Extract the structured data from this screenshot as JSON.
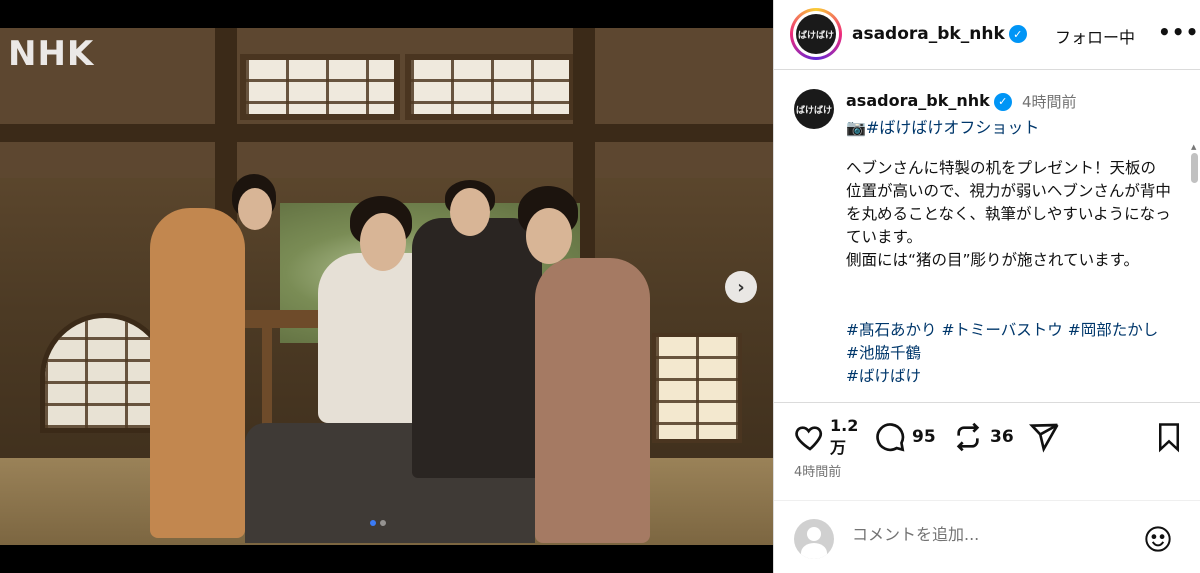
{
  "media": {
    "watermark": "NHK",
    "next_glyph": "›",
    "slide_count": 2,
    "active_slide": 0
  },
  "header": {
    "username": "asadora_bk_nhk",
    "avatar_text": "ばけばけ",
    "follow_label": "フォロー中",
    "more_glyph": "•••"
  },
  "caption": {
    "username": "asadora_bk_nhk",
    "time": "4時間前",
    "camera_icon": "📷",
    "tagline": "#ばけばけオフショット",
    "body": "ヘブンさんに特製の机をプレゼント！天板の位置が高いので、視力が弱いヘブンさんが背中を丸めることなく、執筆がしやすいようになっています。\n側面には“猪の目”彫りが施されています。",
    "hashtags": [
      "#髙石あかり",
      "#トミーバストウ",
      "#岡部たかし",
      "#池脇千鶴",
      "#ばけばけ"
    ]
  },
  "actions": {
    "likes": "1.2万",
    "comments": "95",
    "reposts": "36",
    "time": "4時間前",
    "icons": [
      "heart-icon",
      "comment-icon",
      "repost-icon",
      "share-icon",
      "bookmark-icon"
    ]
  },
  "comment": {
    "placeholder": "コメントを追加..."
  },
  "colors": {
    "accent": "#0095f6",
    "hashtag": "#00376b",
    "muted": "#737373"
  }
}
